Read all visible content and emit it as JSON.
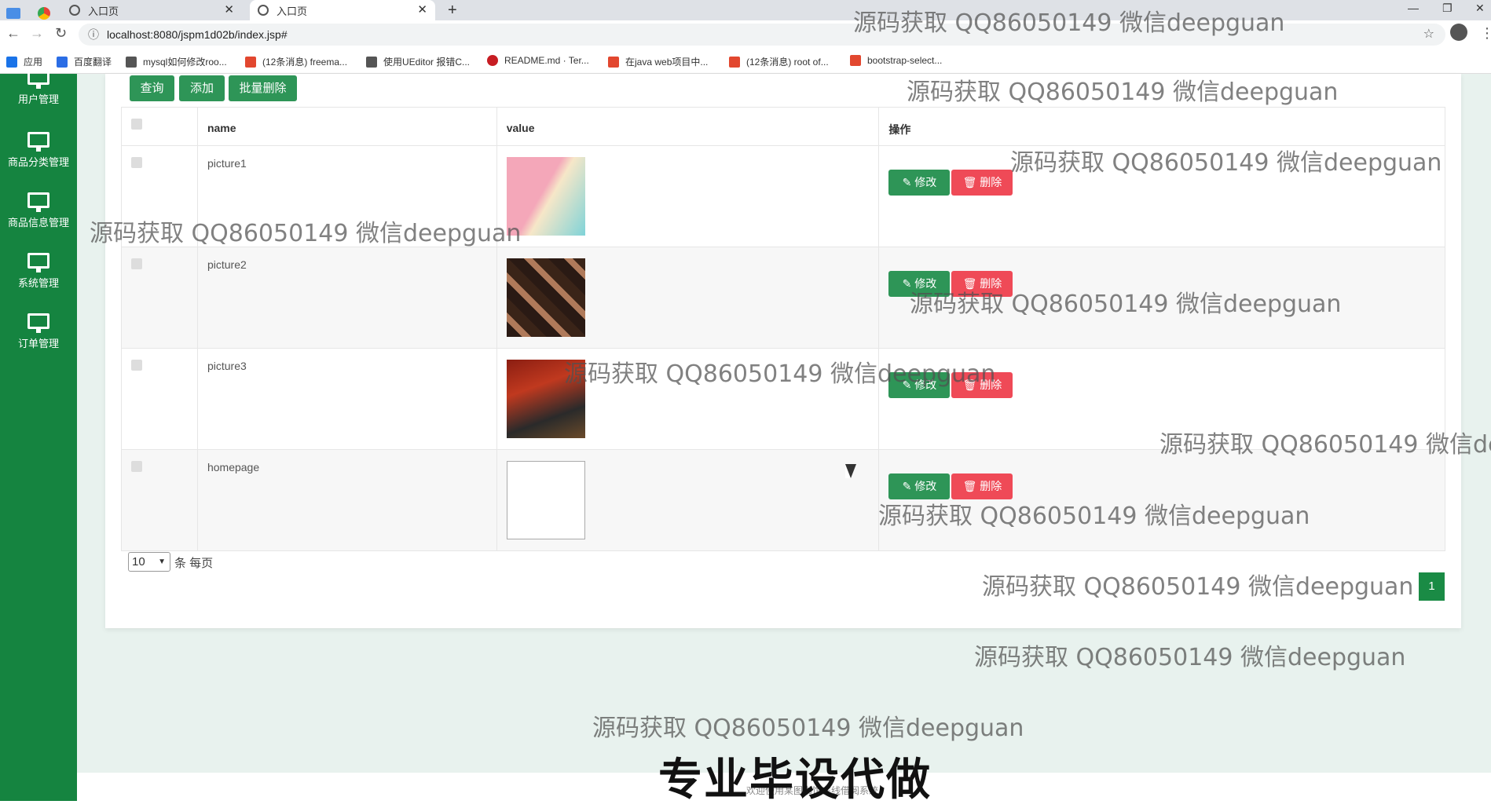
{
  "browser": {
    "tabs": [
      {
        "label": "入口页"
      },
      {
        "label": "入口页"
      }
    ],
    "new_tab": "+",
    "url": "localhost:8080/jspm1d02b/index.jsp#",
    "bookmarks": [
      {
        "label": "应用",
        "icon": "apps-icon",
        "color": "#1a73e8"
      },
      {
        "label": "百度翻译",
        "icon": "baidu-translate-icon",
        "color": "#2b6de5"
      },
      {
        "label": "mysql如何修改roo...",
        "icon": "mysql-icon",
        "color": "#555555"
      },
      {
        "label": "(12条消息) freema...",
        "icon": "csdn-icon",
        "color": "#e2472f"
      },
      {
        "label": "使用UEditor 报错C...",
        "icon": "ueditor-icon",
        "color": "#555555"
      },
      {
        "label": "README.md · Ter...",
        "icon": "gitee-icon",
        "color": "#c71d23"
      },
      {
        "label": "在java web项目中...",
        "icon": "csdn-icon",
        "color": "#e2472f"
      },
      {
        "label": "(12条消息) root of...",
        "icon": "csdn-icon",
        "color": "#e2472f"
      },
      {
        "label": "bootstrap-select...",
        "icon": "jianshu-icon",
        "color": "#e2472f"
      }
    ]
  },
  "sidebar": {
    "items": [
      {
        "label": "用户管理"
      },
      {
        "label": "商品分类管理"
      },
      {
        "label": "商品信息管理"
      },
      {
        "label": "系统管理"
      },
      {
        "label": "订单管理"
      }
    ]
  },
  "toolbar": {
    "query_label": "查询",
    "add_label": "添加",
    "batch_delete_label": "批量删除"
  },
  "table": {
    "headers": {
      "name": "name",
      "value": "value",
      "ops": "操作"
    },
    "rows": [
      {
        "name": "picture1",
        "edit": "修改",
        "delete": "删除",
        "thumb_colors": [
          "#f4a7b9",
          "#7fd3d8"
        ]
      },
      {
        "name": "picture2",
        "edit": "修改",
        "delete": "删除",
        "thumb_colors": [
          "#2a1a14",
          "#b07a5a"
        ]
      },
      {
        "name": "picture3",
        "edit": "修改",
        "delete": "删除",
        "thumb_colors": [
          "#8b1e12",
          "#2a2a2a"
        ]
      },
      {
        "name": "homepage",
        "edit": "修改",
        "delete": "删除",
        "thumb_colors": [
          "#ffffff",
          "#ffffff"
        ]
      }
    ]
  },
  "pagination": {
    "page_size": "10",
    "page_size_label": "条 每页",
    "current_page": "1"
  },
  "watermark": "源码获取 QQ86050149 微信deepguan",
  "watermark_cut": "源码获取 QQ86050149 微信de",
  "promo": "专业毕设代做",
  "footer": "欢迎使用某图书馆在线借阅系统"
}
